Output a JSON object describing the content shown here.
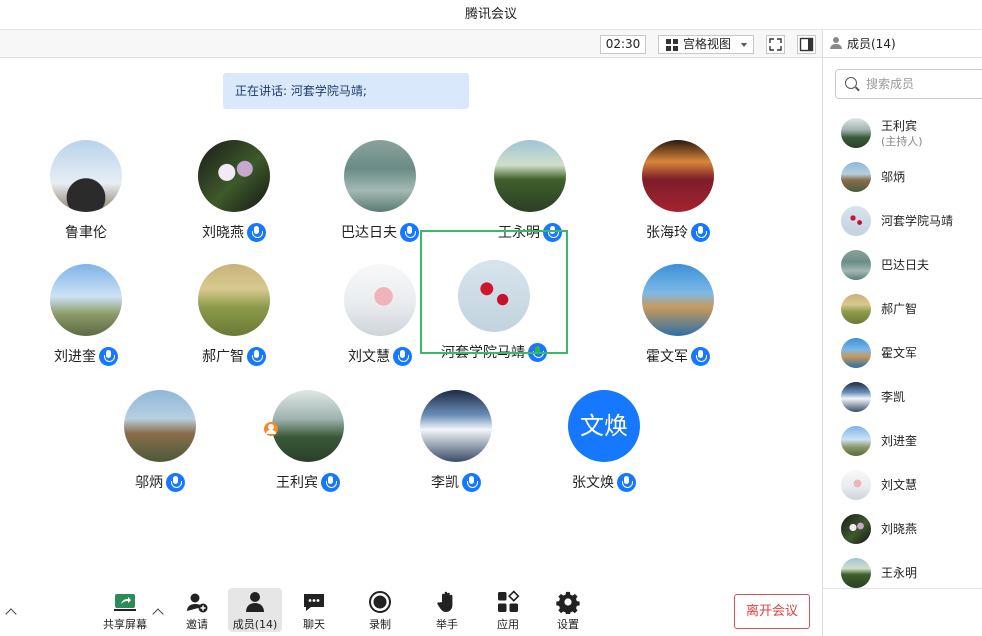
{
  "window": {
    "title": "腾讯会议"
  },
  "topbar": {
    "timer": "02:30",
    "view_mode": "宫格视图"
  },
  "speaking": {
    "text": "正在讲话: 河套学院马靖;"
  },
  "participants": [
    {
      "name": "鲁聿伦",
      "mic": false
    },
    {
      "name": "刘晓燕",
      "mic": true
    },
    {
      "name": "巴达日夫",
      "mic": true
    },
    {
      "name": "王永明",
      "mic": true
    },
    {
      "name": "张海玲",
      "mic": true
    },
    {
      "name": "刘进奎",
      "mic": true
    },
    {
      "name": "郝广智",
      "mic": true
    },
    {
      "name": "刘文慧",
      "mic": true
    },
    {
      "name": "河套学院马靖",
      "mic": true,
      "active": true
    },
    {
      "name": "霍文军",
      "mic": true
    },
    {
      "name": "邬炳",
      "mic": true
    },
    {
      "name": "王利宾",
      "mic": true,
      "host": true
    },
    {
      "name": "李凯",
      "mic": true
    },
    {
      "name": "张文焕",
      "mic": true,
      "avatar_text": "文焕"
    }
  ],
  "toolbar": {
    "share_screen": "共享屏幕",
    "invite": "邀请",
    "members": "成员(14)",
    "chat": "聊天",
    "record": "录制",
    "raise_hand": "举手",
    "apps": "应用",
    "settings": "设置",
    "leave": "离开会议"
  },
  "sidebar": {
    "title": "成员(14)",
    "search_placeholder": "搜索成员",
    "members": [
      {
        "name": "王利宾",
        "sub": "(主持人)"
      },
      {
        "name": "邬炳"
      },
      {
        "name": "河套学院马靖"
      },
      {
        "name": "巴达日夫"
      },
      {
        "name": "郝广智"
      },
      {
        "name": "霍文军"
      },
      {
        "name": "李凯"
      },
      {
        "name": "刘进奎"
      },
      {
        "name": "刘文慧"
      },
      {
        "name": "刘晓燕"
      },
      {
        "name": "王永明"
      }
    ]
  },
  "colors": {
    "accent": "#1677ff",
    "active_border": "#3bb869",
    "leave": "#e04040",
    "host_badge": "#f28a2a"
  }
}
